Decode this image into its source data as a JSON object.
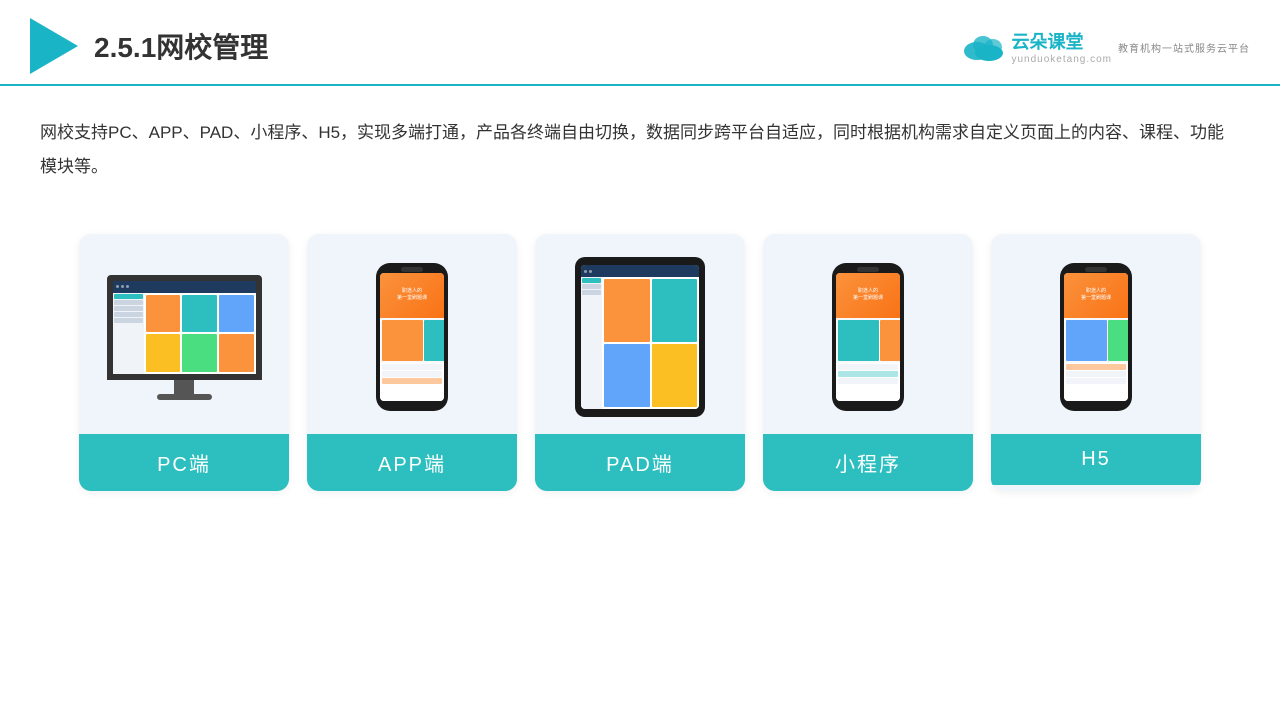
{
  "header": {
    "section_number": "2.5.1",
    "title": "网校管理",
    "brand": {
      "name": "云朵课堂",
      "url": "yunduoketang.com",
      "tagline": "教育机构一站式服务云平台"
    }
  },
  "description": "网校支持PC、APP、PAD、小程序、H5，实现多端打通，产品各终端自由切换，数据同步跨平台自适应，同时根据机构需求自定义页面上的内容、课程、功能模块等。",
  "cards": [
    {
      "id": "pc",
      "label": "PC端",
      "type": "monitor"
    },
    {
      "id": "app",
      "label": "APP端",
      "type": "phone"
    },
    {
      "id": "pad",
      "label": "PAD端",
      "type": "tablet"
    },
    {
      "id": "miniapp",
      "label": "小程序",
      "type": "phone"
    },
    {
      "id": "h5",
      "label": "H5",
      "type": "phone"
    }
  ],
  "colors": {
    "accent": "#1ab4c7",
    "teal": "#2dbfbf",
    "text_primary": "#333333",
    "bg_card": "#f0f4fb"
  }
}
